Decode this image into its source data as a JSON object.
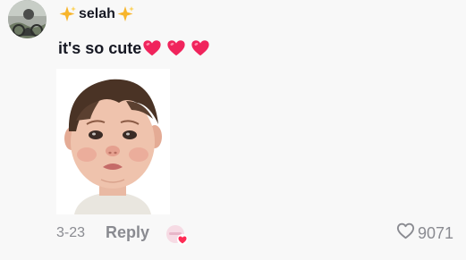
{
  "comment": {
    "username": "selah",
    "text": "it's so cute",
    "date": "3-23",
    "reply_label": "Reply",
    "like_count": "9071"
  },
  "icons": {
    "username_decoration": "sparkles-icon",
    "comment_emojis": [
      "heart-emoji-icon",
      "heart-emoji-icon",
      "heart-emoji-icon"
    ],
    "like": "heart-outline-icon"
  },
  "colors": {
    "background": "#f8f8f8",
    "text_primary": "#161823",
    "text_secondary": "#8a8b91",
    "heart": "#fe2c55",
    "sparkle": "#f7b52c"
  }
}
